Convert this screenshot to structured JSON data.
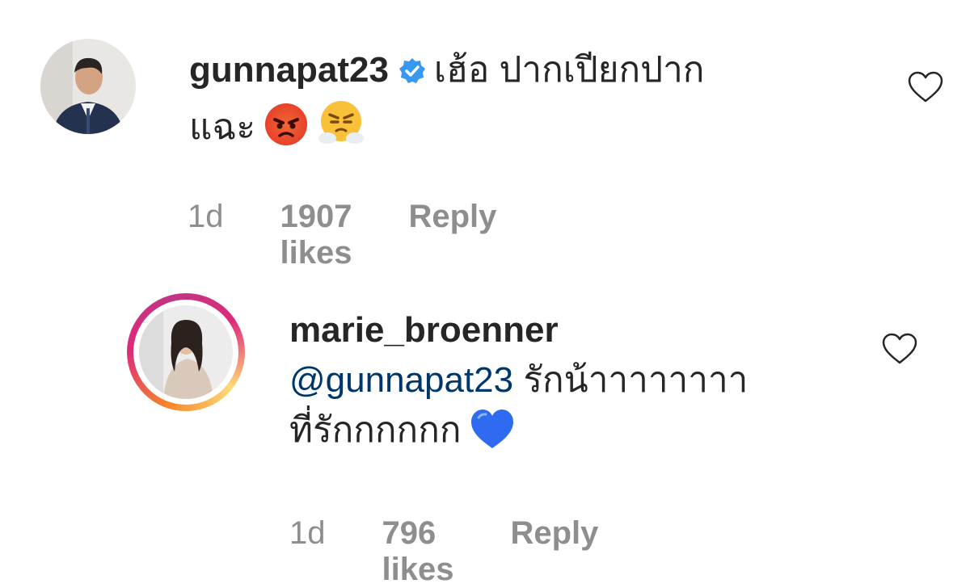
{
  "comments": [
    {
      "username": "gunnapat23",
      "verified": true,
      "text_line1": "เฮ้อ ปากเปียกปาก",
      "text_line2": "แฉะ",
      "emojis": [
        "angry-face-icon",
        "face-with-steam-icon"
      ],
      "time": "1d",
      "likes": "1907 likes",
      "reply": "Reply"
    },
    {
      "username": "marie_broenner",
      "mention": "@gunnapat23",
      "text_line1": "รักน้าาาาาาาา",
      "text_line2": "ที่รักกกกกก",
      "emojis": [
        "blue-heart-icon"
      ],
      "time": "1d",
      "likes": "796 likes",
      "reply": "Reply"
    }
  ],
  "colors": {
    "text": "#262626",
    "muted": "#8e8e8e",
    "mention": "#00376b",
    "verified": "#3897f0",
    "story_ring_start": "#f58529",
    "story_ring_end": "#dd2a7b"
  }
}
